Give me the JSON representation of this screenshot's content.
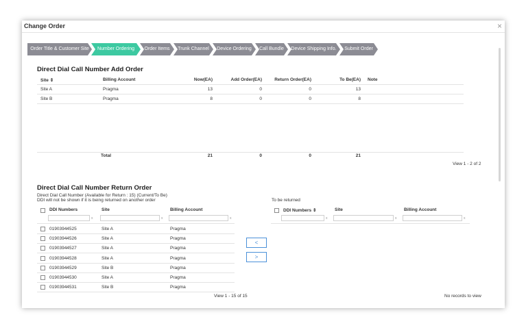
{
  "dialog": {
    "title": "Change Order",
    "close": "×"
  },
  "steps": [
    {
      "label": "Order Title & Customer Site",
      "active": false
    },
    {
      "label": "Number Ordering",
      "active": true
    },
    {
      "label": "Order Items",
      "active": false
    },
    {
      "label": "Trunk Channel",
      "active": false
    },
    {
      "label": "Device Ordering",
      "active": false
    },
    {
      "label": "Call Bundle",
      "active": false
    },
    {
      "label": "Device Shipping Info.",
      "active": false
    },
    {
      "label": "Submit Order",
      "active": false
    }
  ],
  "add_order": {
    "title": "Direct Dial Call Number Add Order",
    "columns": {
      "site": "Site ⇕",
      "billing": "Billing Account",
      "now": "Now(EA)",
      "add": "Add Order(EA)",
      "return": "Return Order(EA)",
      "tobe": "To Be(EA)",
      "note": "Note"
    },
    "rows": [
      {
        "site": "Site A",
        "billing": "Pragma",
        "now": "13",
        "add": "0",
        "return": "0",
        "tobe": "13"
      },
      {
        "site": "Site B",
        "billing": "Pragma",
        "now": "8",
        "add": "0",
        "return": "0",
        "tobe": "8"
      }
    ],
    "total": {
      "label": "Total",
      "now": "21",
      "add": "0",
      "return": "0",
      "tobe": "21"
    },
    "pager": "View 1 - 2 of 2"
  },
  "return_order": {
    "title": "Direct Dial Call Number Return Order",
    "desc1": "Direct Dial Call Number (Available for Return : 15) (Current/To Be)",
    "desc2": "DDI will not be shown if it is being returned on another order",
    "left": {
      "columns": {
        "ddi": "DDI Numbers",
        "site": "Site",
        "billing": "Billing Account"
      },
      "rows": [
        {
          "ddi": "01903944525",
          "site": "Site A",
          "billing": "Pragma"
        },
        {
          "ddi": "01903944526",
          "site": "Site A",
          "billing": "Pragma"
        },
        {
          "ddi": "01903944527",
          "site": "Site A",
          "billing": "Pragma"
        },
        {
          "ddi": "01903944528",
          "site": "Site A",
          "billing": "Pragma"
        },
        {
          "ddi": "01903944529",
          "site": "Site B",
          "billing": "Pragma"
        },
        {
          "ddi": "01903944530",
          "site": "Site A",
          "billing": "Pragma"
        },
        {
          "ddi": "01903944531",
          "site": "Site B",
          "billing": "Pragma"
        }
      ],
      "pager": "View 1 - 15 of 15"
    },
    "move_left": "<",
    "move_right": ">",
    "right": {
      "label": "To be returned",
      "columns": {
        "ddi": "DDI Numbers ⇕",
        "site": "Site",
        "billing": "Billing Account"
      },
      "pager": "No records to view"
    },
    "filter_clear": "x"
  },
  "colors": {
    "active_step": "#3dc9a1",
    "step": "#8c8c94",
    "button": "#4a90d9"
  }
}
